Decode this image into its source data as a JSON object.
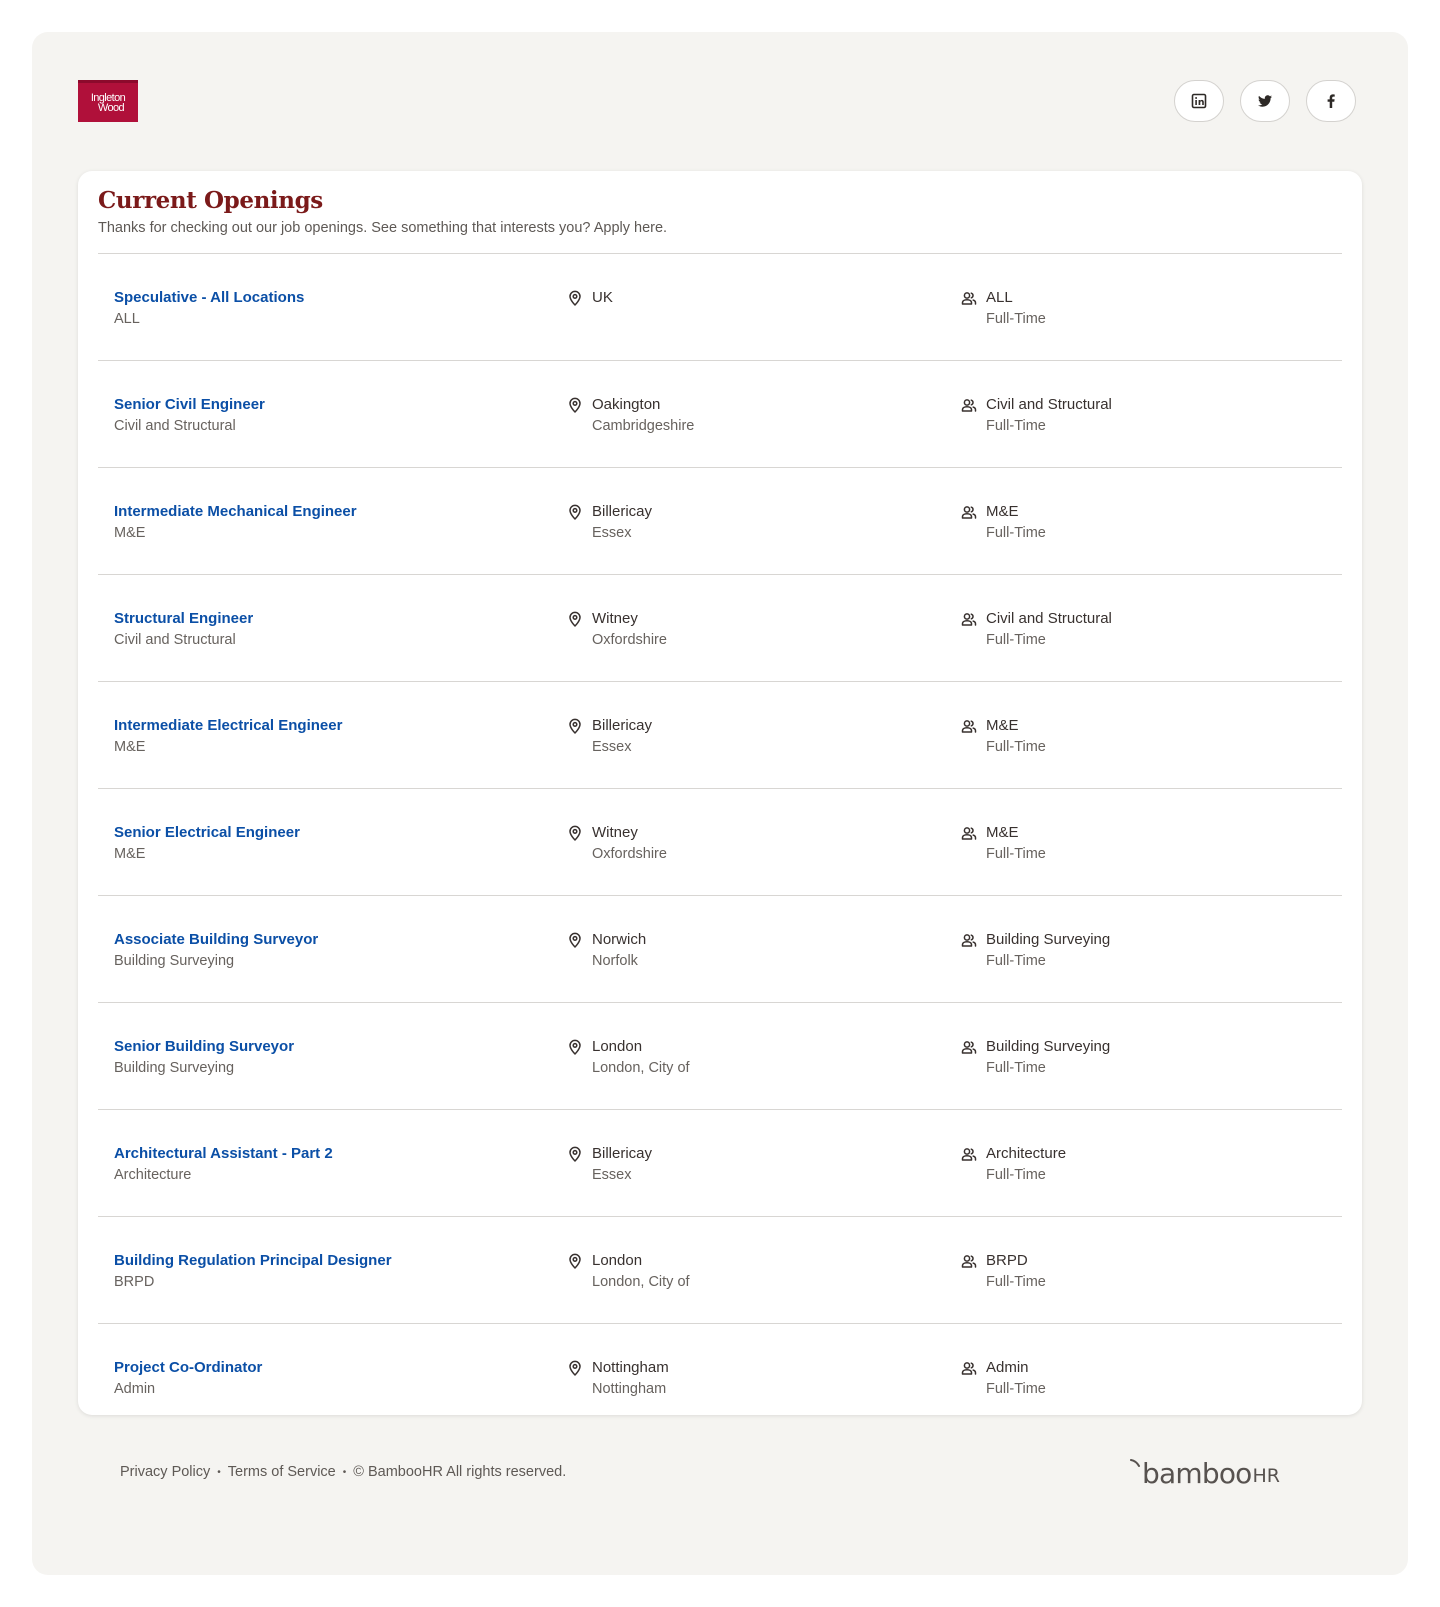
{
  "brand": {
    "logo_line1": "Ingleton",
    "logo_line2": "Wood",
    "logo_color": "#b0103a"
  },
  "social": [
    {
      "icon": "linkedin-icon",
      "label": "LinkedIn"
    },
    {
      "icon": "twitter-icon",
      "label": "Twitter"
    },
    {
      "icon": "facebook-icon",
      "label": "Facebook"
    }
  ],
  "openings": {
    "title": "Current Openings",
    "subtitle": "Thanks for checking out our job openings. See something that interests you? Apply here.",
    "jobs": [
      {
        "title": "Speculative - All Locations",
        "department": "ALL",
        "city": "UK",
        "region": "",
        "team": "ALL",
        "type": "Full-Time"
      },
      {
        "title": "Senior Civil Engineer",
        "department": "Civil and Structural",
        "city": "Oakington",
        "region": "Cambridgeshire",
        "team": "Civil and Structural",
        "type": "Full-Time"
      },
      {
        "title": "Intermediate Mechanical Engineer",
        "department": "M&E",
        "city": "Billericay",
        "region": "Essex",
        "team": "M&E",
        "type": "Full-Time"
      },
      {
        "title": "Structural Engineer",
        "department": "Civil and Structural",
        "city": "Witney",
        "region": "Oxfordshire",
        "team": "Civil and Structural",
        "type": "Full-Time"
      },
      {
        "title": "Intermediate Electrical Engineer",
        "department": "M&E",
        "city": "Billericay",
        "region": "Essex",
        "team": "M&E",
        "type": "Full-Time"
      },
      {
        "title": "Senior Electrical Engineer",
        "department": "M&E",
        "city": "Witney",
        "region": "Oxfordshire",
        "team": "M&E",
        "type": "Full-Time"
      },
      {
        "title": "Associate Building Surveyor",
        "department": "Building Surveying",
        "city": "Norwich",
        "region": "Norfolk",
        "team": "Building Surveying",
        "type": "Full-Time"
      },
      {
        "title": "Senior Building Surveyor",
        "department": "Building Surveying",
        "city": "London",
        "region": "London, City of",
        "team": "Building Surveying",
        "type": "Full-Time"
      },
      {
        "title": "Architectural Assistant - Part 2",
        "department": "Architecture",
        "city": "Billericay",
        "region": "Essex",
        "team": "Architecture",
        "type": "Full-Time"
      },
      {
        "title": "Building Regulation Principal Designer",
        "department": "BRPD",
        "city": "London",
        "region": "London, City of",
        "team": "BRPD",
        "type": "Full-Time"
      },
      {
        "title": "Project Co-Ordinator",
        "department": "Admin",
        "city": "Nottingham",
        "region": "Nottingham",
        "team": "Admin",
        "type": "Full-Time"
      }
    ]
  },
  "footer": {
    "privacy": "Privacy Policy",
    "terms": "Terms of Service",
    "separator": "•",
    "copyright": "© BambooHR All rights reserved.",
    "powered_by": "bamboo",
    "powered_by_suffix": "HR"
  },
  "colors": {
    "link": "#0b4fa6",
    "title": "#7b1a1a",
    "page_bg": "#f5f4f1"
  }
}
